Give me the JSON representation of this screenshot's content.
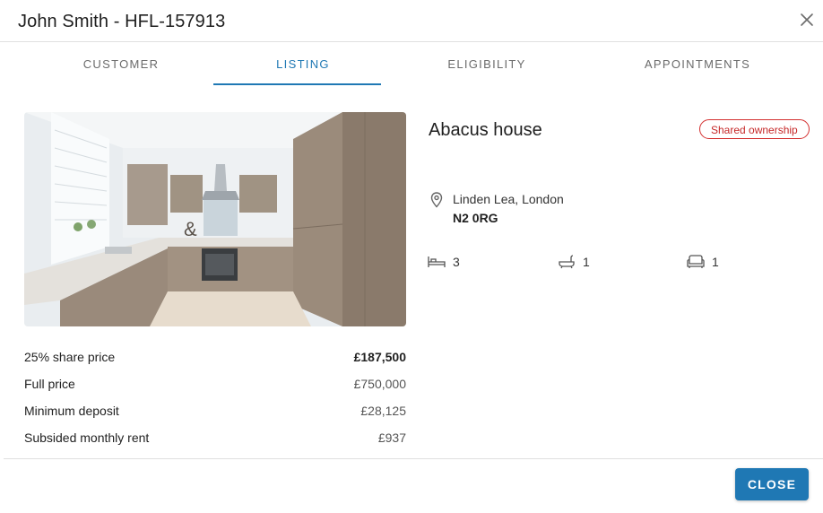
{
  "dialog": {
    "title": "John Smith - HFL-157913",
    "close_icon": "close-icon"
  },
  "tabs": [
    {
      "label": "CUSTOMER",
      "active": false
    },
    {
      "label": "LISTING",
      "active": true
    },
    {
      "label": "ELIGIBILITY",
      "active": false
    },
    {
      "label": "APPOINTMENTS",
      "active": false
    }
  ],
  "listing": {
    "name": "Abacus house",
    "badge": "Shared ownership",
    "address_line1": "Linden Lea, London",
    "postcode": "N2 0RG",
    "features": [
      {
        "icon": "bed-icon",
        "value": "3"
      },
      {
        "icon": "bath-icon",
        "value": "1"
      },
      {
        "icon": "sofa-icon",
        "value": "1"
      }
    ],
    "prices": [
      {
        "label": "25% share price",
        "value": "£187,500",
        "bold": true
      },
      {
        "label": "Full price",
        "value": "£750,000",
        "bold": false
      },
      {
        "label": "Minimum deposit",
        "value": "£28,125",
        "bold": false
      },
      {
        "label": "Subsided monthly rent",
        "value": "£937",
        "bold": false
      }
    ]
  },
  "footer": {
    "close_label": "CLOSE"
  },
  "colors": {
    "accent": "#1f78b4",
    "badge": "#d32f2f"
  }
}
